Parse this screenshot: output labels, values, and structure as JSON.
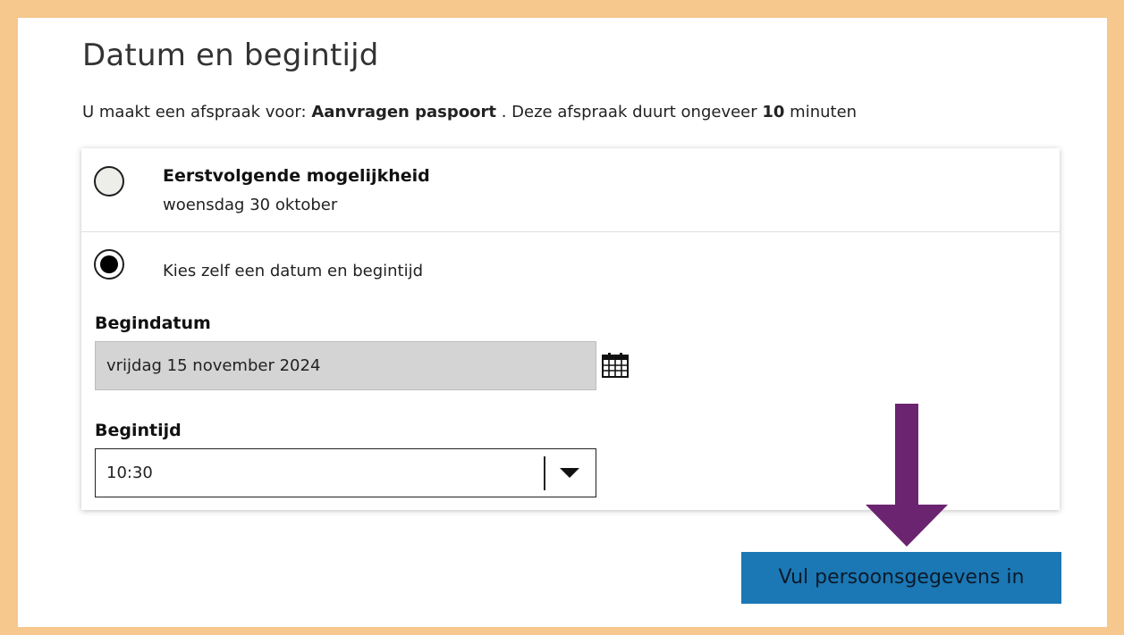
{
  "page": {
    "title": "Datum en begintijd"
  },
  "intro": {
    "prefix": "U maakt een afspraak voor: ",
    "service": "Aanvragen paspoort",
    "middle": " . Deze afspraak duurt ongeveer ",
    "duration": "10",
    "suffix": " minuten"
  },
  "options": {
    "first": {
      "title": "Eerstvolgende mogelijkheid",
      "date": "woensdag 30 oktober",
      "selected": false
    },
    "custom": {
      "label": "Kies zelf een datum en begintijd",
      "selected": true
    }
  },
  "start_date": {
    "label": "Begindatum",
    "value": "vrijdag 15 november 2024",
    "icon": "calendar-icon"
  },
  "start_time": {
    "label": "Begintijd",
    "value": "10:30",
    "icon": "caret-down-icon"
  },
  "submit": {
    "label": "Vul persoonsgegevens in"
  },
  "colors": {
    "frame": "#f6c88e",
    "button": "#1c78b4",
    "arrow": "#6b2470",
    "date_field": "#d4d4d4"
  }
}
